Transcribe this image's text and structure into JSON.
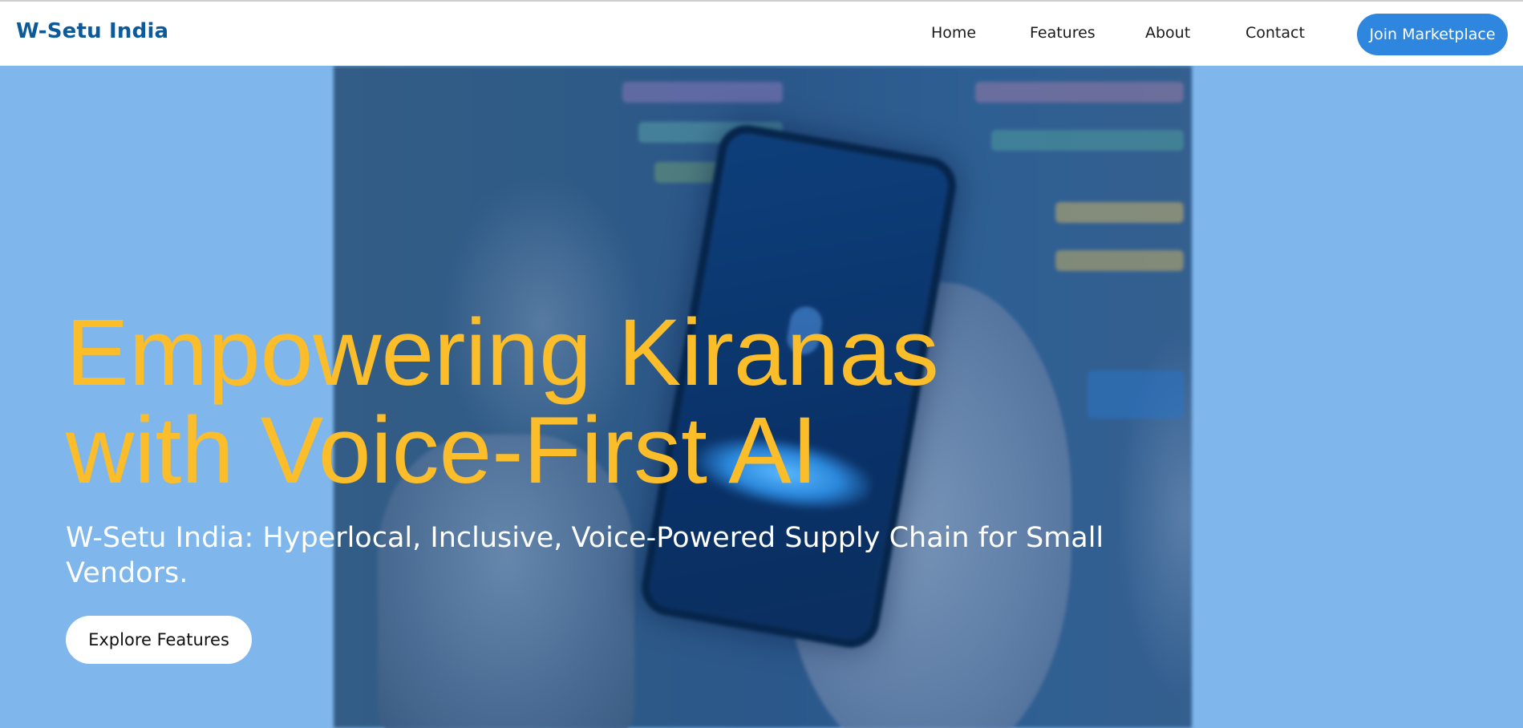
{
  "header": {
    "brand": "W-Setu India",
    "nav": {
      "home": "Home",
      "features": "Features",
      "about": "About",
      "contact": "Contact"
    },
    "cta_label": "Join Marketplace"
  },
  "hero": {
    "title_line1": "Empowering Kiranas",
    "title_line2": "with Voice-First AI",
    "subtitle": "W-Setu India: Hyperlocal, Inclusive, Voice-Powered Supply Chain for Small Vendors.",
    "cta_label": "Explore Features",
    "image_subject": "shopkeeper-phone-voice-app"
  },
  "colors": {
    "brand": "#0d5a98",
    "accent": "#2f86de",
    "hero_background": "#7fb6ec",
    "title": "#fbbd2a"
  }
}
